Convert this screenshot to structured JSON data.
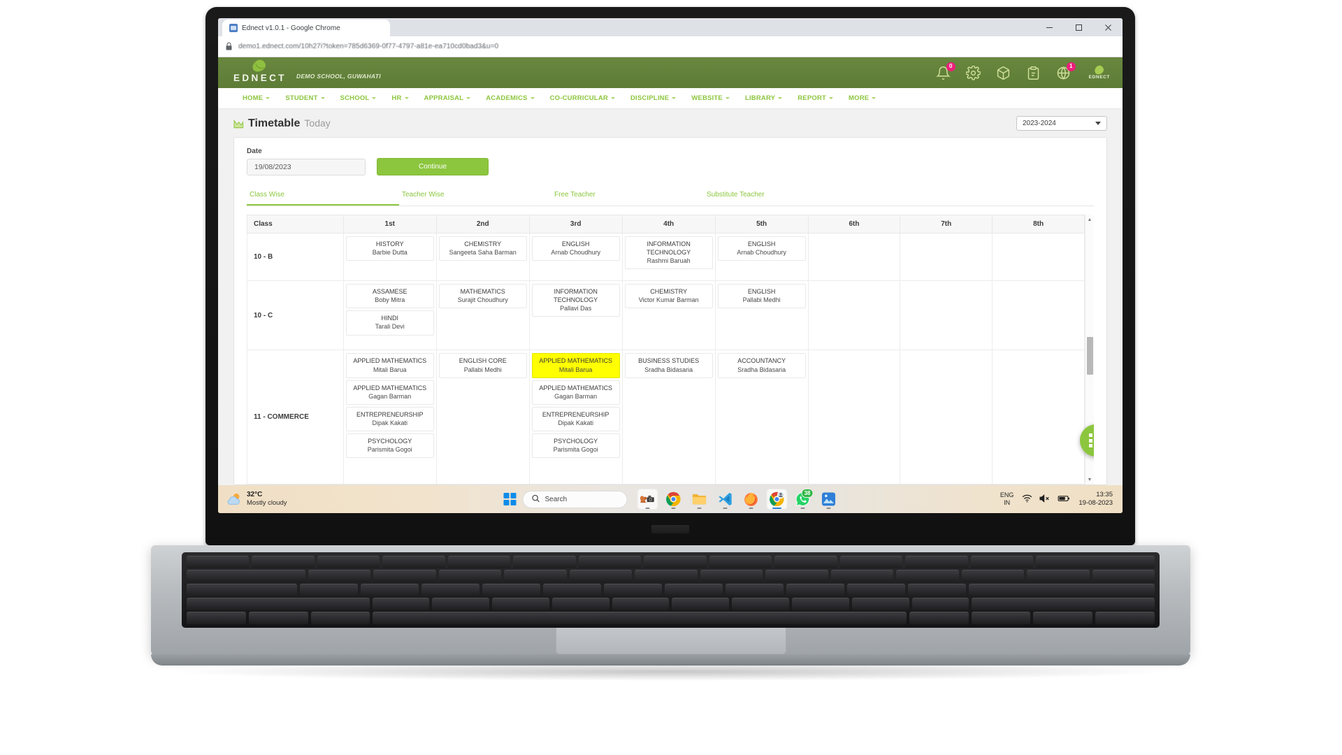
{
  "browser": {
    "tab_title": "Ednect v1.0.1 - Google Chrome",
    "url": "demo1.ednect.com/10h27i?token=785d6369-0f77-4797-a81e-ea710cd0bad3&u=0",
    "minimize_label": "Minimize",
    "maximize_label": "Maximize",
    "close_label": "Close"
  },
  "app_header": {
    "brand_name": "EDNECT",
    "school_name": "DEMO SCHOOL, GUWAHATI",
    "icons": [
      {
        "name": "bell-icon",
        "badge": "0"
      },
      {
        "name": "gear-icon",
        "badge": ""
      },
      {
        "name": "box-icon",
        "badge": ""
      },
      {
        "name": "clipboard-icon",
        "badge": ""
      },
      {
        "name": "globe-icon",
        "badge": "1"
      }
    ],
    "mini_logo_text": "EDNECT"
  },
  "nav": {
    "items": [
      {
        "label": "HOME"
      },
      {
        "label": "STUDENT"
      },
      {
        "label": "SCHOOL"
      },
      {
        "label": "HR"
      },
      {
        "label": "APPRAISAL"
      },
      {
        "label": "ACADEMICS"
      },
      {
        "label": "CO-CURRICULAR"
      },
      {
        "label": "DISCIPLINE"
      },
      {
        "label": "WEBSITE"
      },
      {
        "label": "LIBRARY"
      },
      {
        "label": "REPORT"
      },
      {
        "label": "MORE"
      }
    ]
  },
  "page": {
    "title_strong": "Timetable",
    "title_light": "Today",
    "academic_year": "2023-2024"
  },
  "filters": {
    "date_label": "Date",
    "date_value": "19/08/2023",
    "continue_label": "Continue"
  },
  "tabs": [
    {
      "label": "Class Wise",
      "active": true
    },
    {
      "label": "Teacher Wise",
      "active": false
    },
    {
      "label": "Free Teacher",
      "active": false
    },
    {
      "label": "Substitute Teacher",
      "active": false
    }
  ],
  "timetable": {
    "columns": [
      "Class",
      "1st",
      "2nd",
      "3rd",
      "4th",
      "5th",
      "6th",
      "7th",
      "8th"
    ],
    "rows": [
      {
        "class": "10 - B",
        "periods": [
          [
            {
              "subject": "HISTORY",
              "teacher": "Barbie Dutta",
              "highlight": false
            }
          ],
          [
            {
              "subject": "CHEMISTRY",
              "teacher": "Sangeeta Saha Barman",
              "highlight": false
            }
          ],
          [
            {
              "subject": "ENGLISH",
              "teacher": "Arnab Choudhury",
              "highlight": false
            }
          ],
          [
            {
              "subject": "INFORMATION TECHNOLOGY",
              "teacher": "Rashmi Baruah",
              "highlight": false
            }
          ],
          [
            {
              "subject": "ENGLISH",
              "teacher": "Arnab Choudhury",
              "highlight": false
            }
          ],
          [],
          [],
          []
        ]
      },
      {
        "class": "10 - C",
        "periods": [
          [
            {
              "subject": "ASSAMESE",
              "teacher": "Boby Mitra",
              "highlight": false
            },
            {
              "subject": "HINDI",
              "teacher": "Tarali Devi",
              "highlight": false
            }
          ],
          [
            {
              "subject": "MATHEMATICS",
              "teacher": "Surajit Choudhury",
              "highlight": false
            }
          ],
          [
            {
              "subject": "INFORMATION TECHNOLOGY",
              "teacher": "Pallavi Das",
              "highlight": false
            }
          ],
          [
            {
              "subject": "CHEMISTRY",
              "teacher": "Victor Kumar Barman",
              "highlight": false
            }
          ],
          [
            {
              "subject": "ENGLISH",
              "teacher": "Pallabi Medhi",
              "highlight": false
            }
          ],
          [],
          [],
          []
        ]
      },
      {
        "class": "11 - COMMERCE",
        "periods": [
          [
            {
              "subject": "APPLIED MATHEMATICS",
              "teacher": "Mitali Barua",
              "highlight": false
            },
            {
              "subject": "APPLIED MATHEMATICS",
              "teacher": "Gagan Barman",
              "highlight": false
            },
            {
              "subject": "ENTREPRENEURSHIP",
              "teacher": "Dipak Kakati",
              "highlight": false
            },
            {
              "subject": "PSYCHOLOGY",
              "teacher": "Parismita Gogoi",
              "highlight": false
            }
          ],
          [
            {
              "subject": "ENGLISH CORE",
              "teacher": "Pallabi Medhi",
              "highlight": false
            }
          ],
          [
            {
              "subject": "APPLIED MATHEMATICS",
              "teacher": "Mitali Barua",
              "highlight": true
            },
            {
              "subject": "APPLIED MATHEMATICS",
              "teacher": "Gagan Barman",
              "highlight": false
            },
            {
              "subject": "ENTREPRENEURSHIP",
              "teacher": "Dipak Kakati",
              "highlight": false
            },
            {
              "subject": "PSYCHOLOGY",
              "teacher": "Parismita Gogoi",
              "highlight": false
            }
          ],
          [
            {
              "subject": "BUSINESS STUDIES",
              "teacher": "Sradha Bidasaria",
              "highlight": false
            }
          ],
          [
            {
              "subject": "ACCOUNTANCY",
              "teacher": "Sradha Bidasaria",
              "highlight": false
            }
          ],
          [],
          [],
          []
        ]
      }
    ]
  },
  "fab": {
    "name": "apps-grid-fab"
  },
  "taskbar": {
    "weather_temp": "32°C",
    "weather_condition": "Mostly cloudy",
    "search_placeholder": "Search",
    "apps": [
      {
        "name": "squirrel-camera-app",
        "active": true,
        "badge": ""
      },
      {
        "name": "google-chrome-app",
        "active": false,
        "badge": ""
      },
      {
        "name": "file-explorer-app",
        "active": false,
        "badge": ""
      },
      {
        "name": "vscode-app",
        "active": false,
        "badge": ""
      },
      {
        "name": "firefox-app",
        "active": false,
        "badge": ""
      },
      {
        "name": "chrome-profile-app",
        "active": true,
        "badge": ""
      },
      {
        "name": "whatsapp-app",
        "active": false,
        "badge": "38"
      },
      {
        "name": "photos-app",
        "active": false,
        "badge": ""
      }
    ],
    "lang_line1": "ENG",
    "lang_line2": "IN",
    "time": "13:35",
    "date": "19-08-2023"
  },
  "colors": {
    "brand_green": "#8cc63e",
    "header_green": "#5d7c36",
    "highlight_yellow": "#ffff00",
    "badge_pink": "#ec1f7a"
  }
}
